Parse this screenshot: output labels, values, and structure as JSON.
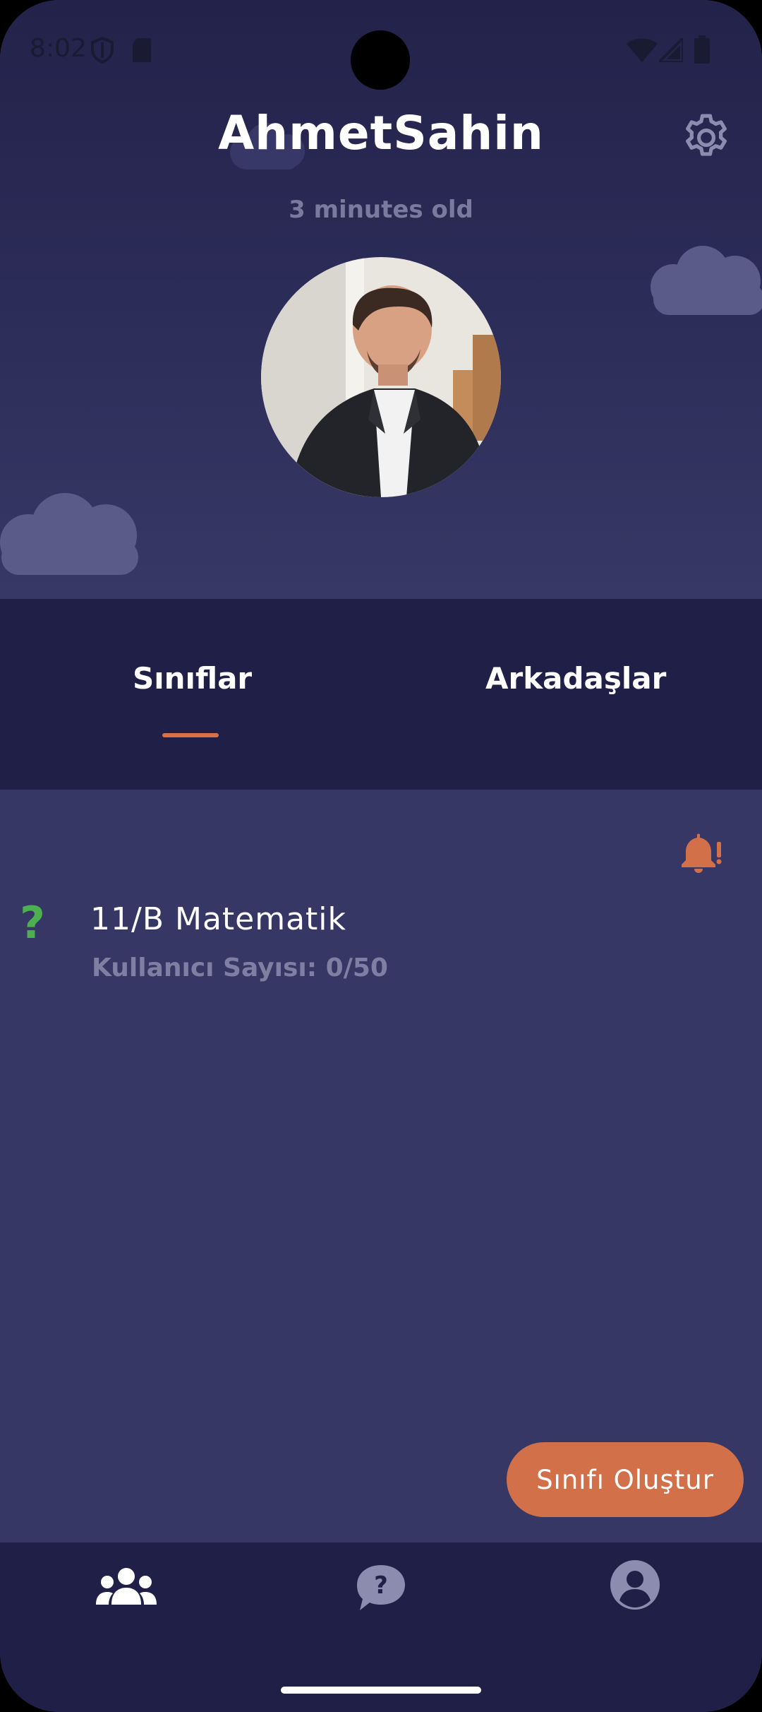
{
  "status_bar": {
    "time": "8:02",
    "icons": [
      "shield-icon",
      "sd-card-icon",
      "wifi-icon",
      "signal-icon",
      "battery-icon"
    ]
  },
  "profile": {
    "username": "AhmetSahin",
    "age_label": "3 minutes old",
    "avatar": "profile-photo"
  },
  "tabs": [
    {
      "label": "Sınıflar",
      "selected": true
    },
    {
      "label": "Arkadaşlar",
      "selected": false
    }
  ],
  "classes": [
    {
      "status_icon": "?",
      "name": "11/B Matematik",
      "user_count": "Kullanıcı Sayısı: 0/50"
    }
  ],
  "create_button": {
    "label": "Sınıfı Oluştur"
  },
  "bottom_nav": [
    {
      "icon": "group-icon",
      "active": true
    },
    {
      "icon": "question-chat-icon",
      "active": false
    },
    {
      "icon": "account-icon",
      "active": false
    }
  ],
  "colors": {
    "accent": "#d2704a",
    "background": "#373766",
    "bar": "#1f1f47",
    "success": "#4caf50"
  }
}
